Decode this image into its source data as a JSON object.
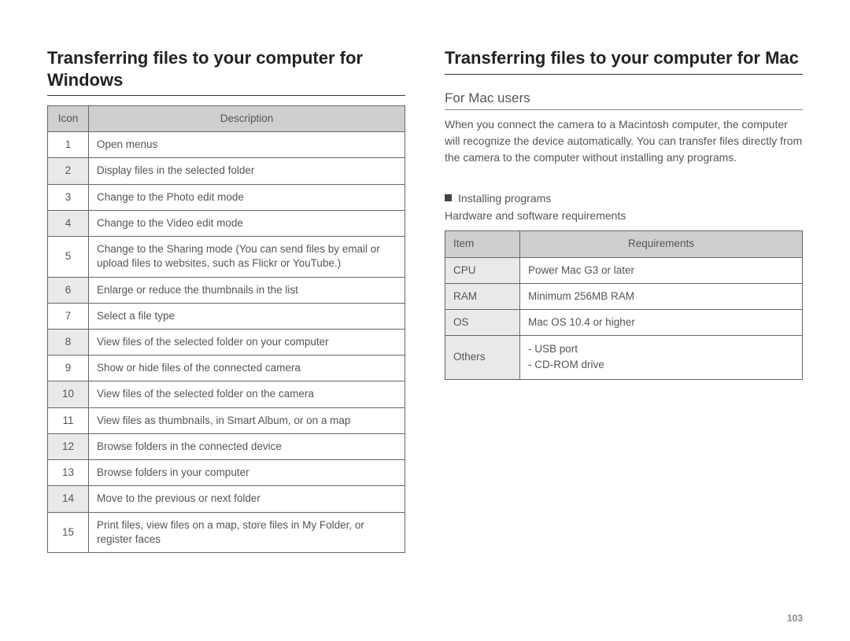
{
  "left": {
    "title": "Transferring files to your computer for Windows",
    "table": {
      "headers": [
        "Icon",
        "Description"
      ],
      "rows": [
        {
          "icon": "1",
          "desc": "Open menus"
        },
        {
          "icon": "2",
          "desc": "Display files in the selected folder"
        },
        {
          "icon": "3",
          "desc": "Change to the Photo edit mode"
        },
        {
          "icon": "4",
          "desc": "Change to the Video edit mode"
        },
        {
          "icon": "5",
          "desc": "Change to the Sharing mode (You can send files by email or upload files to websites, such as Flickr or YouTube.)"
        },
        {
          "icon": "6",
          "desc": "Enlarge or reduce the thumbnails in the list"
        },
        {
          "icon": "7",
          "desc": "Select a file type"
        },
        {
          "icon": "8",
          "desc": "View files of the selected folder on your computer"
        },
        {
          "icon": "9",
          "desc": "Show or hide files of the connected camera"
        },
        {
          "icon": "10",
          "desc": "View files of the selected folder on the camera"
        },
        {
          "icon": "11",
          "desc": "View files as thumbnails, in Smart Album, or on a map"
        },
        {
          "icon": "12",
          "desc": "Browse folders in the connected device"
        },
        {
          "icon": "13",
          "desc": "Browse folders in your computer"
        },
        {
          "icon": "14",
          "desc": "Move to the previous or next folder"
        },
        {
          "icon": "15",
          "desc": "Print files, view files on a map, store files in My Folder, or register faces"
        }
      ]
    }
  },
  "right": {
    "title": "Transferring files to your computer for Mac",
    "subheading": "For Mac users",
    "paragraph": "When you connect the camera to a Macintosh computer, the computer will recognize the device automatically. You can transfer files directly from the camera to the computer without installing any programs.",
    "installing_line1": "Installing programs",
    "installing_line2": "Hardware and software requirements",
    "req_table": {
      "headers": [
        "Item",
        "Requirements"
      ],
      "rows": [
        {
          "item": "CPU",
          "req": "Power Mac G3 or later"
        },
        {
          "item": "RAM",
          "req": "Minimum 256MB RAM"
        },
        {
          "item": "OS",
          "req": "Mac OS 10.4 or higher"
        },
        {
          "item": "Others",
          "req": "- USB port\n- CD-ROM drive"
        }
      ]
    }
  },
  "page_number": "103"
}
